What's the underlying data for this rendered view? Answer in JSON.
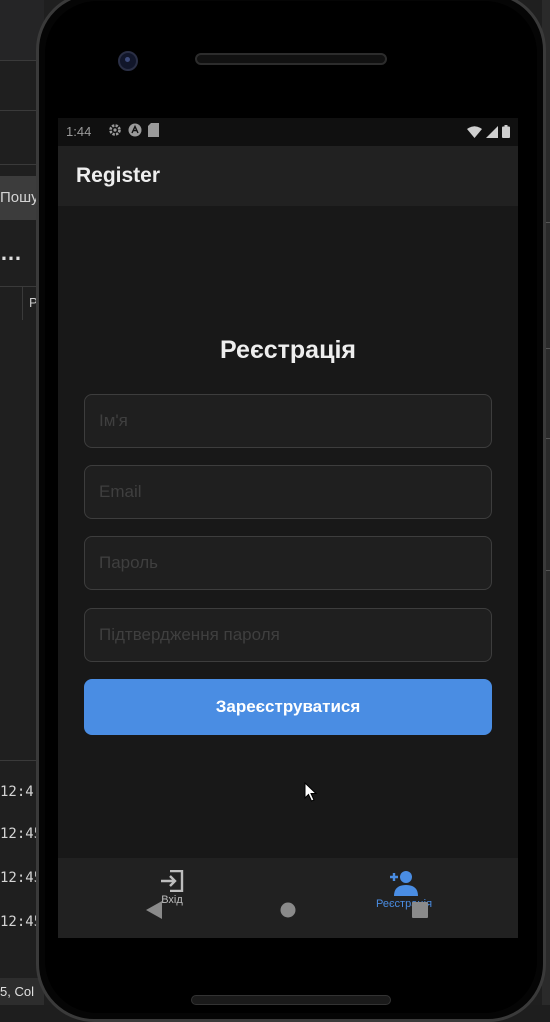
{
  "desktop": {
    "search_partial": "Пошу",
    "more_dots": "…",
    "column_partial": "P",
    "log_lines": [
      "12:4:",
      "12:45",
      "12:45",
      "12:45"
    ],
    "status_partial": "5, Col"
  },
  "device": {
    "status_bar": {
      "time": "1:44"
    },
    "app_bar": {
      "title": "Register"
    },
    "form": {
      "heading": "Реєстрація",
      "name_placeholder": "Ім'я",
      "email_placeholder": "Email",
      "password_placeholder": "Пароль",
      "confirm_placeholder": "Підтвердження пароля",
      "submit_label": "Зареєструватися"
    },
    "bottom_nav": {
      "items": [
        {
          "label": "Вхід",
          "icon": "login-icon",
          "active": false
        },
        {
          "label": "Реєстрація",
          "icon": "person-add-icon",
          "active": true
        }
      ]
    }
  },
  "colors": {
    "accent": "#4a8de3",
    "screen_bg": "#181818",
    "bar_bg": "#212121",
    "text_primary": "#eeeeee",
    "inactive": "#bdbdbd"
  }
}
